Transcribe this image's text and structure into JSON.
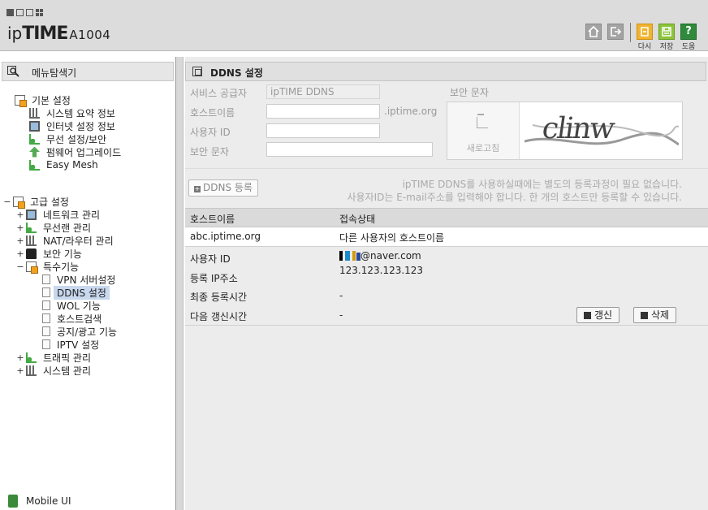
{
  "header": {
    "brand_ip": "ip",
    "brand_time": "TIME",
    "model": "A1004",
    "actions": [
      {
        "label": "다시"
      },
      {
        "label": "저장"
      },
      {
        "label": "도움",
        "glyph": "?"
      }
    ]
  },
  "sidebar": {
    "title": "메뉴탐색기",
    "basic": {
      "label": "기본 설정",
      "items": [
        {
          "label": "시스템 요약 정보"
        },
        {
          "label": "인터넷 설정 정보"
        },
        {
          "label": "무선 설정/보안"
        },
        {
          "label": "펌웨어 업그레이드"
        },
        {
          "label": "Easy Mesh"
        }
      ]
    },
    "advanced": {
      "label": "고급 설정",
      "items": [
        {
          "label": "네트워크 관리"
        },
        {
          "label": "무선랜 관리"
        },
        {
          "label": "NAT/라우터 관리"
        },
        {
          "label": "보안 기능"
        },
        {
          "label": "특수기능"
        }
      ],
      "special_sub": [
        {
          "label": "VPN 서버설정"
        },
        {
          "label": "DDNS 설정"
        },
        {
          "label": "WOL 기능"
        },
        {
          "label": "호스트검색"
        },
        {
          "label": "공지/광고 기능"
        },
        {
          "label": "IPTV 설정"
        }
      ],
      "after": [
        {
          "label": "트래픽 관리"
        },
        {
          "label": "시스템 관리"
        }
      ]
    },
    "mobile_ui": "Mobile UI"
  },
  "main": {
    "title": "DDNS 설정",
    "form": {
      "provider_label": "서비스 공급자",
      "provider_value": "ipTIME DDNS",
      "hostname_label": "호스트이름",
      "hostname_suffix": ".iptime.org",
      "userid_label": "사용자 ID",
      "captcha_label": "보안 문자",
      "captcha_title": "보안 문자",
      "refresh_label": "새로고침",
      "captcha_text": "clinw"
    },
    "register_button": "DDNS 등록",
    "notice_line1": "ipTIME DDNS를 사용하실때에는 별도의 등록과정이 필요 없습니다.",
    "notice_line2": "사용자ID는 E-mail주소를 입력해야 합니다. 한 개의 호스트만 등록할 수 있습니다.",
    "table": {
      "headers": [
        "호스트이름",
        "접속상태"
      ],
      "row": [
        "abc.iptime.org",
        "다른 사용자의 호스트이름"
      ]
    },
    "details": {
      "userid_label": "사용자 ID",
      "userid_value": "@naver.com",
      "ip_label": "등록 IP주소",
      "ip_value": "123.123.123.123",
      "last_label": "최종 등록시간",
      "last_value": "-",
      "next_label": "다음 갱신시간",
      "next_value": "-"
    },
    "renew_button": "갱신",
    "delete_button": "삭제"
  },
  "colors": {
    "header_bg": "#dcdcdc",
    "orange_icon": "#f1b430",
    "green_icon": "#8cc43c",
    "help_icon": "#2f8a3c",
    "selected_item": "#c8d8ee"
  }
}
